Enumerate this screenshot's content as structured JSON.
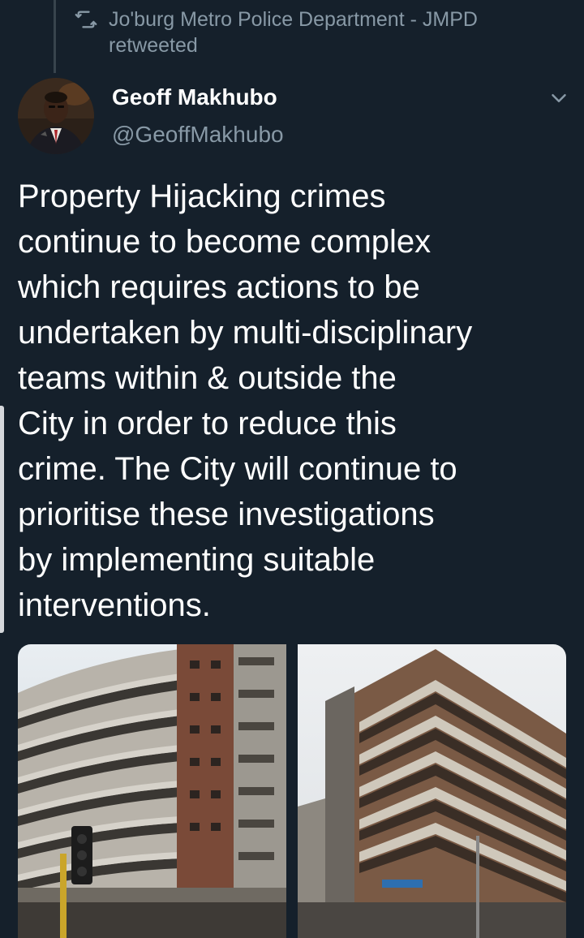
{
  "retweet": {
    "icon": "retweet-icon",
    "text": "Jo'burg Metro Police Department - JMPD retweeted"
  },
  "author": {
    "name": "Geoff Makhubo",
    "handle": "@GeoffMakhubo",
    "avatar": "avatar-photo"
  },
  "menu": {
    "icon": "chevron-down-icon"
  },
  "tweet": {
    "text": "Property Hijacking crimes\ncontinue to become complex\nwhich requires actions to be\nundertaken by multi-disciplinary\nteams within & outside the\nCity in order to reduce this\ncrime. The City will continue to\nprioritise these investigations\nby implementing suitable\ninterventions."
  },
  "media": {
    "images": [
      "building-photo-1",
      "building-photo-2"
    ]
  },
  "colors": {
    "background": "#15202b",
    "secondary_text": "#8899a6",
    "primary_text": "#ffffff"
  }
}
